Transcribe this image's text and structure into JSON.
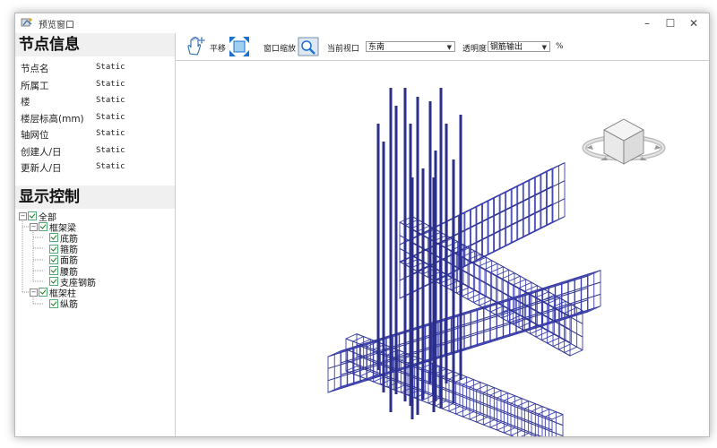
{
  "window": {
    "title": "预览窗口",
    "controls": {
      "minimize": "–",
      "maximize": "☐",
      "close": "✕"
    }
  },
  "node_info": {
    "heading": "节点信息",
    "rows": [
      {
        "label": "节点名",
        "value": "Static"
      },
      {
        "label": "所属工",
        "value": "Static"
      },
      {
        "label": "楼",
        "value": "Static"
      },
      {
        "label": "楼层标高(mm)",
        "value": "Static"
      },
      {
        "label": "轴网位",
        "value": "Static"
      },
      {
        "label": "创建人/日",
        "value": "Static"
      },
      {
        "label": "更新人/日",
        "value": "Static"
      }
    ]
  },
  "display_control": {
    "heading": "显示控制",
    "tree": [
      {
        "label": "全部",
        "level": 0,
        "expander": "−",
        "checked": true
      },
      {
        "label": "框架梁",
        "level": 1,
        "expander": "−",
        "checked": true
      },
      {
        "label": "底筋",
        "level": 2,
        "checked": true
      },
      {
        "label": "箍筋",
        "level": 2,
        "checked": true
      },
      {
        "label": "面筋",
        "level": 2,
        "checked": true
      },
      {
        "label": "腰筋",
        "level": 2,
        "checked": true
      },
      {
        "label": "支座钢筋",
        "level": 2,
        "checked": true
      },
      {
        "label": "框架柱",
        "level": 1,
        "expander": "−",
        "checked": true
      },
      {
        "label": "纵筋",
        "level": 2,
        "checked": true
      }
    ]
  },
  "toolbar": {
    "pan_label": "平移",
    "zoom_window_label": "窗口缩放",
    "current_view_label": "当前视口",
    "current_view_value": "东南",
    "transparency_label": "透明度",
    "transparency_value": "钢筋输出",
    "percent_symbol": "%"
  },
  "icons": {
    "app": "app-icon",
    "pan": "hand-pan-icon",
    "fit": "fit-extent-icon",
    "zoom_window": "zoom-window-icon",
    "view_cube": "view-cube-icon"
  },
  "colors": {
    "rebar": "#2b2f8a",
    "stirrup": "#3a3fb0",
    "accent": "#1e6fd0"
  }
}
